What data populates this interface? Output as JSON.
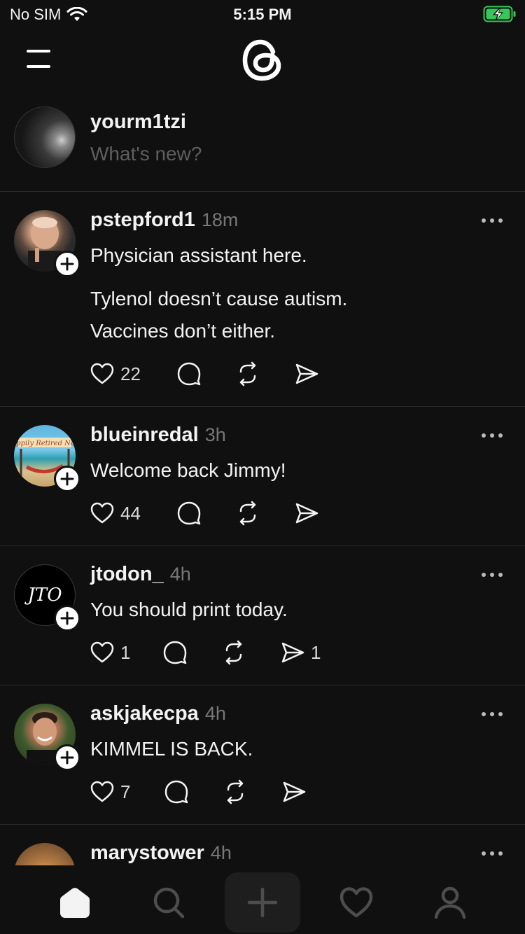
{
  "status_bar": {
    "carrier": "No SIM",
    "time": "5:15 PM",
    "battery_color": "#34c759"
  },
  "composer": {
    "username": "yourm1tzi",
    "placeholder": "What's new?"
  },
  "posts": [
    {
      "handle": "pstepford1",
      "time": "18m",
      "paragraphs": [
        "Physician assistant here.",
        "Tylenol doesn’t cause autism.\nVaccines don’t either."
      ],
      "likes": "22",
      "replies": "",
      "reposts": "",
      "shares": ""
    },
    {
      "handle": "blueinredal",
      "time": "3h",
      "paragraphs": [
        "Welcome back Jimmy!"
      ],
      "likes": "44",
      "replies": "",
      "reposts": "",
      "shares": "",
      "avatar_text": "Happily Retired Now!"
    },
    {
      "handle": "jtodon_",
      "time": "4h",
      "paragraphs": [
        "You should print today."
      ],
      "likes": "1",
      "replies": "",
      "reposts": "",
      "shares": "1",
      "avatar_text": "JTO"
    },
    {
      "handle": "askjakecpa",
      "time": "4h",
      "paragraphs": [
        "KIMMEL IS BACK."
      ],
      "likes": "7",
      "replies": "",
      "reposts": "",
      "shares": ""
    },
    {
      "handle": "marystower",
      "time": "4h",
      "paragraphs": [],
      "likes": "",
      "replies": "",
      "reposts": "",
      "shares": ""
    }
  ],
  "icons": {
    "menu": "hamburger-menu-icon",
    "logo": "threads-logo",
    "like": "heart-icon",
    "reply": "comment-bubble-icon",
    "repost": "repost-icon",
    "share": "send-icon",
    "tabs": [
      "home-icon",
      "search-icon",
      "plus-icon",
      "heart-icon",
      "profile-icon"
    ]
  }
}
